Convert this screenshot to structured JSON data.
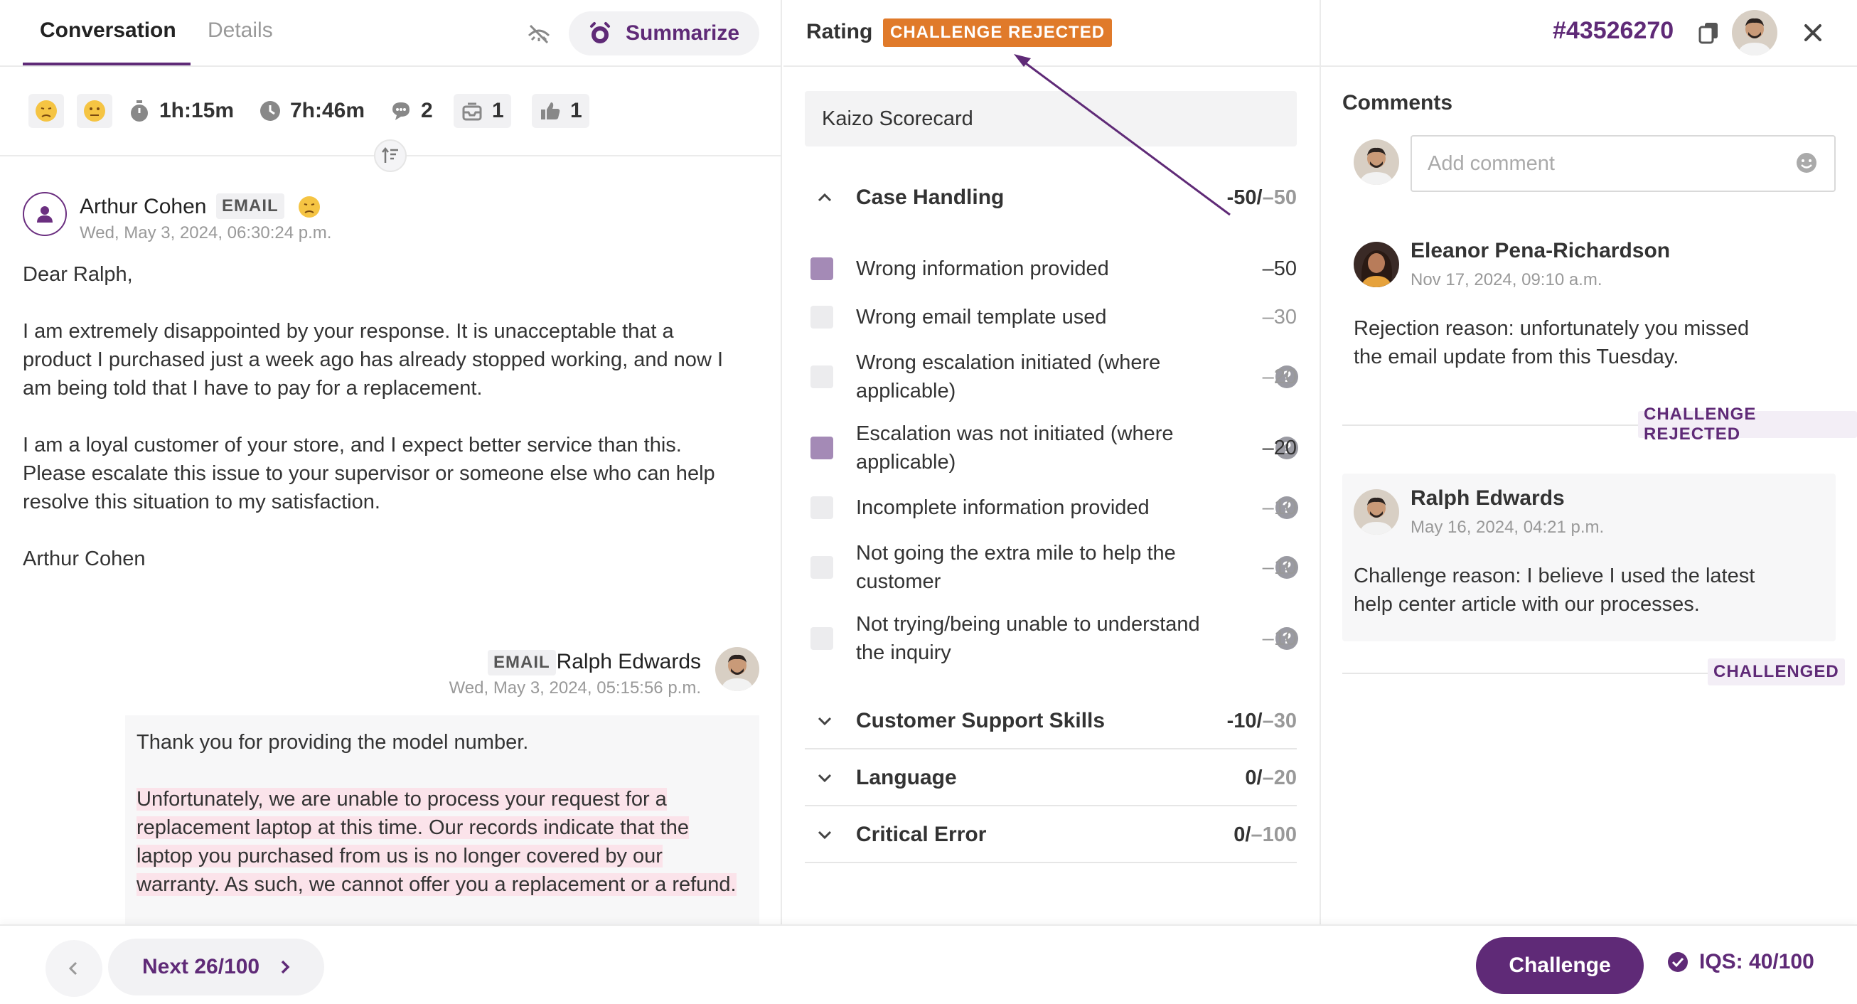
{
  "left": {
    "tabs": {
      "conversation": "Conversation",
      "details": "Details"
    },
    "summarize_label": "Summarize",
    "stats": {
      "handle_time": "1h:15m",
      "response_time": "7h:46m",
      "messages": "2",
      "inbox": "1",
      "likes": "1"
    },
    "message1": {
      "author": "Arthur Cohen",
      "channel": "EMAIL",
      "date": "Wed, May 3, 2024, 06:30:24 p.m.",
      "greeting": "Dear Ralph,",
      "paragraphs": [
        "I am extremely disappointed by your response. It is unacceptable that a product I purchased just a week ago has already stopped working, and now I am being told that I have to pay for a replacement.",
        "I am a loyal customer of your store, and I expect better service than this. Please escalate this issue to your supervisor or someone else who can help resolve this situation to my satisfaction."
      ],
      "signature": "Arthur Cohen"
    },
    "message2": {
      "author": "Ralph Edwards",
      "channel": "EMAIL",
      "date": "Wed, May 3, 2024, 05:15:56 p.m.",
      "line1": "Thank you for providing the model number.",
      "highlighted": "Unfortunately, we are unable to process your request for a replacement laptop at this time. Our records indicate that the laptop you purchased from us is no longer covered by our warranty. As such, we cannot offer you a replacement or a refund."
    }
  },
  "middle": {
    "title": "Rating",
    "badge": "CHALLENGE REJECTED",
    "scorecard": "Kaizo Scorecard",
    "categories": [
      {
        "name": "Case Handling",
        "score": "-50/",
        "max": "–50"
      },
      {
        "name": "Customer Support Skills",
        "score": "-10/",
        "max": "–30"
      },
      {
        "name": "Language",
        "score": "0/",
        "max": "–20"
      },
      {
        "name": "Critical Error",
        "score": "0/",
        "max": "–100"
      }
    ],
    "items": [
      {
        "label": "Wrong information provided",
        "value": "–50",
        "checked": true
      },
      {
        "label": "Wrong email template used",
        "value": "–30",
        "checked": false
      },
      {
        "label": "Wrong escalation initiated (where applicable)",
        "value": "–20",
        "checked": false
      },
      {
        "label": "Escalation was not initiated (where applicable)",
        "value": "–20",
        "checked": true
      },
      {
        "label": "Incomplete information provided",
        "value": "–10",
        "checked": false
      },
      {
        "label": "Not going the extra mile to help the customer",
        "value": "–10",
        "checked": false
      },
      {
        "label": "Not trying/being unable to understand the inquiry",
        "value": "–10",
        "checked": false
      }
    ],
    "help_glyph": "?"
  },
  "right": {
    "ticket_id": "#43526270",
    "comments_title": "Comments",
    "comment_placeholder": "Add comment",
    "comments": [
      {
        "author": "Eleanor Pena-Richardson",
        "date": "Nov 17, 2024, 09:10 a.m.",
        "body": "Rejection reason: unfortunately you missed the email update from this Tuesday.",
        "status": "CHALLENGE REJECTED"
      },
      {
        "author": "Ralph Edwards",
        "date": "May 16, 2024, 04:21 p.m.",
        "body": "Challenge reason: I believe I used the latest help center article with our processes.",
        "status": "CHALLENGED"
      }
    ]
  },
  "bottom": {
    "next_label": "Next 26/100",
    "challenge_label": "Challenge",
    "iqs_label": "IQS: 40/100"
  },
  "colors": {
    "brand": "#5f2a77",
    "badge_orange": "#e07a2a",
    "checkbox_checked": "#a48ab6",
    "highlight": "#fbe3ea"
  },
  "icons": {
    "hide": "eye-off-icon",
    "summarize": "ai-sparkle-icon",
    "stopwatch": "stopwatch-icon",
    "clock": "clock-icon",
    "chat": "chat-bubble-icon",
    "inbox": "inbox-icon",
    "thumbs": "thumbs-up-icon",
    "copy": "copy-icon",
    "close": "close-icon"
  }
}
